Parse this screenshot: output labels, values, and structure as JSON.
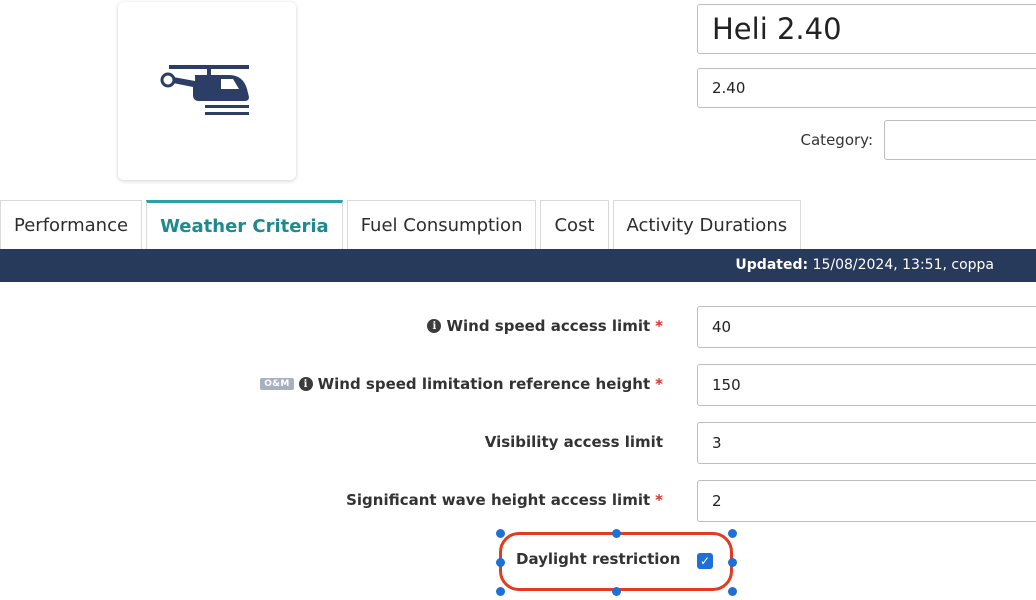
{
  "vessel": {
    "name": "Heli 2.40",
    "code": "2.40",
    "category_label": "Category:",
    "category_value": "",
    "image_icon": "helicopter-icon"
  },
  "tabs": [
    {
      "label": "Performance",
      "active": false
    },
    {
      "label": "Weather Criteria",
      "active": true
    },
    {
      "label": "Fuel Consumption",
      "active": false
    },
    {
      "label": "Cost",
      "active": false
    },
    {
      "label": "Activity Durations",
      "active": false
    }
  ],
  "status": {
    "updated_label": "Updated:",
    "updated_value": "15/08/2024, 13:51, coppa"
  },
  "form": {
    "wind_speed_access": {
      "label": "Wind speed access limit",
      "value": "40",
      "required": "*"
    },
    "wind_speed_ref_height": {
      "badge": "O&M",
      "label": "Wind speed limitation reference height",
      "value": "150",
      "required": "*"
    },
    "visibility_access": {
      "label": "Visibility access limit",
      "value": "3"
    },
    "wave_height_access": {
      "label": "Significant wave height access limit",
      "value": "2",
      "required": "*"
    },
    "daylight_restriction": {
      "label": "Daylight restriction",
      "checked": true
    }
  },
  "colors": {
    "accent": "#2aa1a6",
    "status_bar": "#283a5b",
    "icon": "#2c3e66",
    "required": "#d9342b",
    "highlight": "#e23b1f",
    "checkbox": "#1f6fd6"
  }
}
